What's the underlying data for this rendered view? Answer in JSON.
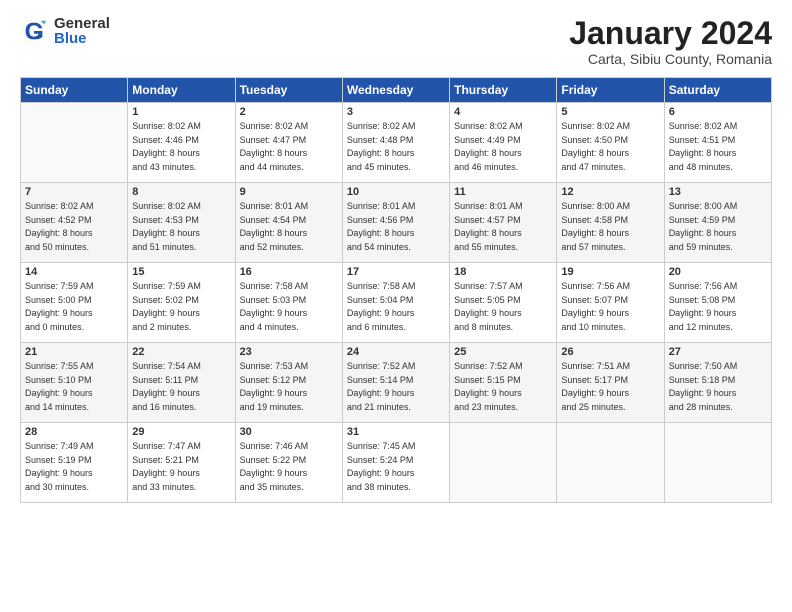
{
  "header": {
    "logo_general": "General",
    "logo_blue": "Blue",
    "month_title": "January 2024",
    "location": "Carta, Sibiu County, Romania"
  },
  "weekdays": [
    "Sunday",
    "Monday",
    "Tuesday",
    "Wednesday",
    "Thursday",
    "Friday",
    "Saturday"
  ],
  "weeks": [
    [
      {
        "day": "",
        "info": ""
      },
      {
        "day": "1",
        "info": "Sunrise: 8:02 AM\nSunset: 4:46 PM\nDaylight: 8 hours\nand 43 minutes."
      },
      {
        "day": "2",
        "info": "Sunrise: 8:02 AM\nSunset: 4:47 PM\nDaylight: 8 hours\nand 44 minutes."
      },
      {
        "day": "3",
        "info": "Sunrise: 8:02 AM\nSunset: 4:48 PM\nDaylight: 8 hours\nand 45 minutes."
      },
      {
        "day": "4",
        "info": "Sunrise: 8:02 AM\nSunset: 4:49 PM\nDaylight: 8 hours\nand 46 minutes."
      },
      {
        "day": "5",
        "info": "Sunrise: 8:02 AM\nSunset: 4:50 PM\nDaylight: 8 hours\nand 47 minutes."
      },
      {
        "day": "6",
        "info": "Sunrise: 8:02 AM\nSunset: 4:51 PM\nDaylight: 8 hours\nand 48 minutes."
      }
    ],
    [
      {
        "day": "7",
        "info": "Sunrise: 8:02 AM\nSunset: 4:52 PM\nDaylight: 8 hours\nand 50 minutes."
      },
      {
        "day": "8",
        "info": "Sunrise: 8:02 AM\nSunset: 4:53 PM\nDaylight: 8 hours\nand 51 minutes."
      },
      {
        "day": "9",
        "info": "Sunrise: 8:01 AM\nSunset: 4:54 PM\nDaylight: 8 hours\nand 52 minutes."
      },
      {
        "day": "10",
        "info": "Sunrise: 8:01 AM\nSunset: 4:56 PM\nDaylight: 8 hours\nand 54 minutes."
      },
      {
        "day": "11",
        "info": "Sunrise: 8:01 AM\nSunset: 4:57 PM\nDaylight: 8 hours\nand 55 minutes."
      },
      {
        "day": "12",
        "info": "Sunrise: 8:00 AM\nSunset: 4:58 PM\nDaylight: 8 hours\nand 57 minutes."
      },
      {
        "day": "13",
        "info": "Sunrise: 8:00 AM\nSunset: 4:59 PM\nDaylight: 8 hours\nand 59 minutes."
      }
    ],
    [
      {
        "day": "14",
        "info": "Sunrise: 7:59 AM\nSunset: 5:00 PM\nDaylight: 9 hours\nand 0 minutes."
      },
      {
        "day": "15",
        "info": "Sunrise: 7:59 AM\nSunset: 5:02 PM\nDaylight: 9 hours\nand 2 minutes."
      },
      {
        "day": "16",
        "info": "Sunrise: 7:58 AM\nSunset: 5:03 PM\nDaylight: 9 hours\nand 4 minutes."
      },
      {
        "day": "17",
        "info": "Sunrise: 7:58 AM\nSunset: 5:04 PM\nDaylight: 9 hours\nand 6 minutes."
      },
      {
        "day": "18",
        "info": "Sunrise: 7:57 AM\nSunset: 5:05 PM\nDaylight: 9 hours\nand 8 minutes."
      },
      {
        "day": "19",
        "info": "Sunrise: 7:56 AM\nSunset: 5:07 PM\nDaylight: 9 hours\nand 10 minutes."
      },
      {
        "day": "20",
        "info": "Sunrise: 7:56 AM\nSunset: 5:08 PM\nDaylight: 9 hours\nand 12 minutes."
      }
    ],
    [
      {
        "day": "21",
        "info": "Sunrise: 7:55 AM\nSunset: 5:10 PM\nDaylight: 9 hours\nand 14 minutes."
      },
      {
        "day": "22",
        "info": "Sunrise: 7:54 AM\nSunset: 5:11 PM\nDaylight: 9 hours\nand 16 minutes."
      },
      {
        "day": "23",
        "info": "Sunrise: 7:53 AM\nSunset: 5:12 PM\nDaylight: 9 hours\nand 19 minutes."
      },
      {
        "day": "24",
        "info": "Sunrise: 7:52 AM\nSunset: 5:14 PM\nDaylight: 9 hours\nand 21 minutes."
      },
      {
        "day": "25",
        "info": "Sunrise: 7:52 AM\nSunset: 5:15 PM\nDaylight: 9 hours\nand 23 minutes."
      },
      {
        "day": "26",
        "info": "Sunrise: 7:51 AM\nSunset: 5:17 PM\nDaylight: 9 hours\nand 25 minutes."
      },
      {
        "day": "27",
        "info": "Sunrise: 7:50 AM\nSunset: 5:18 PM\nDaylight: 9 hours\nand 28 minutes."
      }
    ],
    [
      {
        "day": "28",
        "info": "Sunrise: 7:49 AM\nSunset: 5:19 PM\nDaylight: 9 hours\nand 30 minutes."
      },
      {
        "day": "29",
        "info": "Sunrise: 7:47 AM\nSunset: 5:21 PM\nDaylight: 9 hours\nand 33 minutes."
      },
      {
        "day": "30",
        "info": "Sunrise: 7:46 AM\nSunset: 5:22 PM\nDaylight: 9 hours\nand 35 minutes."
      },
      {
        "day": "31",
        "info": "Sunrise: 7:45 AM\nSunset: 5:24 PM\nDaylight: 9 hours\nand 38 minutes."
      },
      {
        "day": "",
        "info": ""
      },
      {
        "day": "",
        "info": ""
      },
      {
        "day": "",
        "info": ""
      }
    ]
  ]
}
